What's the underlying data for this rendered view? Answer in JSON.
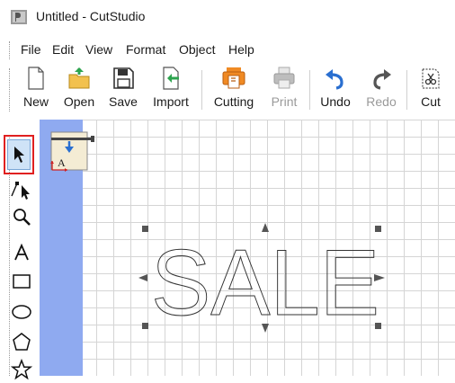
{
  "window": {
    "title": "Untitled - CutStudio"
  },
  "menu": [
    "File",
    "Edit",
    "View",
    "Format",
    "Object",
    "Help"
  ],
  "toolbar": {
    "new": "New",
    "open": "Open",
    "save": "Save",
    "import": "Import",
    "cutting": "Cutting",
    "print": "Print",
    "undo": "Undo",
    "redo": "Redo",
    "cut": "Cut"
  },
  "tools": [
    "select-arrow-icon",
    "node-edit-icon",
    "zoom-icon",
    "text-tool-icon",
    "rectangle-tool-icon",
    "ellipse-tool-icon",
    "polygon-tool-icon",
    "star-tool-icon"
  ],
  "canvas": {
    "text": "SALE"
  },
  "colors": {
    "margin_blue": "#8faaf0",
    "selection_red": "#e02020",
    "accent_orange": "#f08a24",
    "accent_blue": "#2a6fd0"
  }
}
